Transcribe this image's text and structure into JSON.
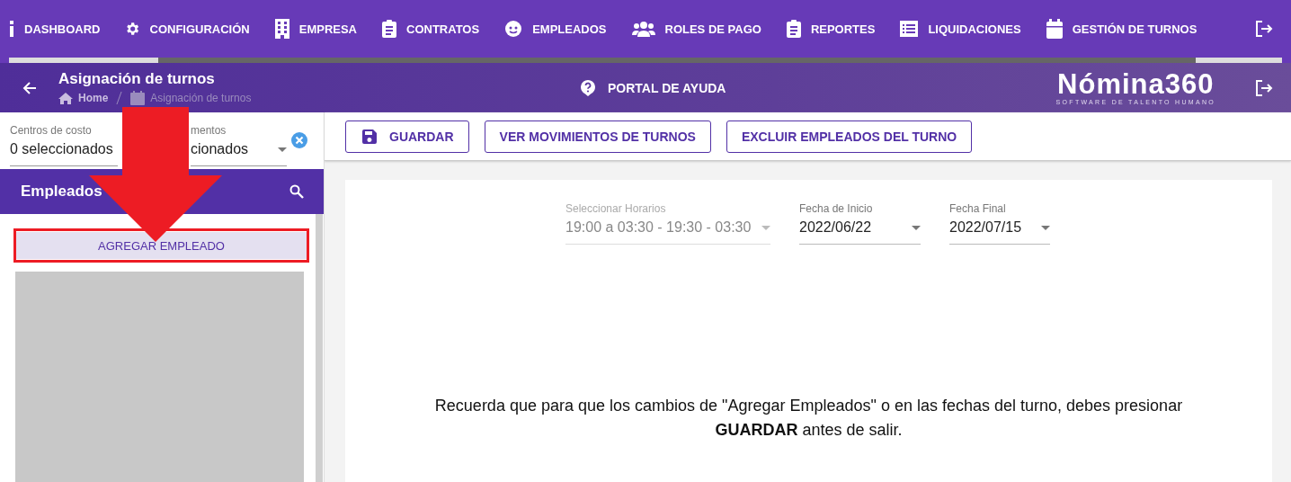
{
  "nav": [
    {
      "label": "DASHBOARD"
    },
    {
      "label": "CONFIGURACIÓN"
    },
    {
      "label": "EMPRESA"
    },
    {
      "label": "CONTRATOS"
    },
    {
      "label": "EMPLEADOS"
    },
    {
      "label": "ROLES DE PAGO"
    },
    {
      "label": "REPORTES"
    },
    {
      "label": "LIQUIDACIONES"
    },
    {
      "label": "GESTIÓN DE TURNOS"
    }
  ],
  "header": {
    "title": "Asignación de turnos",
    "breadcrumb": [
      "Home",
      "Asignación de turnos"
    ],
    "help": "PORTAL DE AYUDA",
    "logo": "Nómina360",
    "logo_tagline": "SOFTWARE DE TALENTO HUMANO"
  },
  "filters": [
    {
      "label": "Centros de costo",
      "value": "0 seleccionados"
    },
    {
      "label": "mentos",
      "value": "cionados"
    }
  ],
  "employees": {
    "title": "Empleados",
    "add_button": "AGREGAR EMPLEADO"
  },
  "toolbar": [
    {
      "label": "GUARDAR"
    },
    {
      "label": "VER MOVIMIENTOS DE TURNOS"
    },
    {
      "label": "EXCLUIR EMPLEADOS DEL TURNO"
    }
  ],
  "fields": [
    {
      "label": "Seleccionar Horarios",
      "value": "19:00 a 03:30 - 19:30 - 03:30",
      "disabled": true
    },
    {
      "label": "Fecha de Inicio",
      "value": "2022/06/22",
      "disabled": false
    },
    {
      "label": "Fecha Final",
      "value": "2022/07/15",
      "disabled": false
    }
  ],
  "notice": "Recuerda que para que los cambios de \"Agregar Empleados\" o en las fechas del turno, debes presionar **GUARDAR** antes de salir."
}
